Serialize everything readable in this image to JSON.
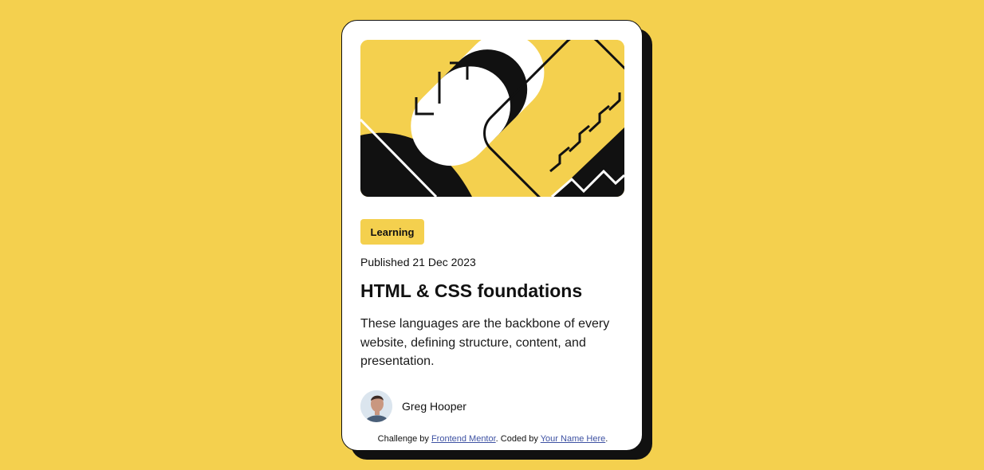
{
  "card": {
    "tag": "Learning",
    "published": "Published 21 Dec 2023",
    "title": "HTML & CSS foundations",
    "description": "These languages are the backbone of every website, defining structure, content, and presentation.",
    "author": "Greg Hooper"
  },
  "attribution": {
    "prefix": "Challenge by ",
    "link1": "Frontend Mentor",
    "middle": ". Coded by ",
    "link2": "Your Name Here",
    "suffix": "."
  },
  "colors": {
    "background": "#F4D04E",
    "card": "#FFFFFF",
    "ink": "#111111",
    "link": "#3E52A3"
  },
  "icons": {
    "hero": "illustration-article",
    "avatar": "avatar-photo"
  }
}
